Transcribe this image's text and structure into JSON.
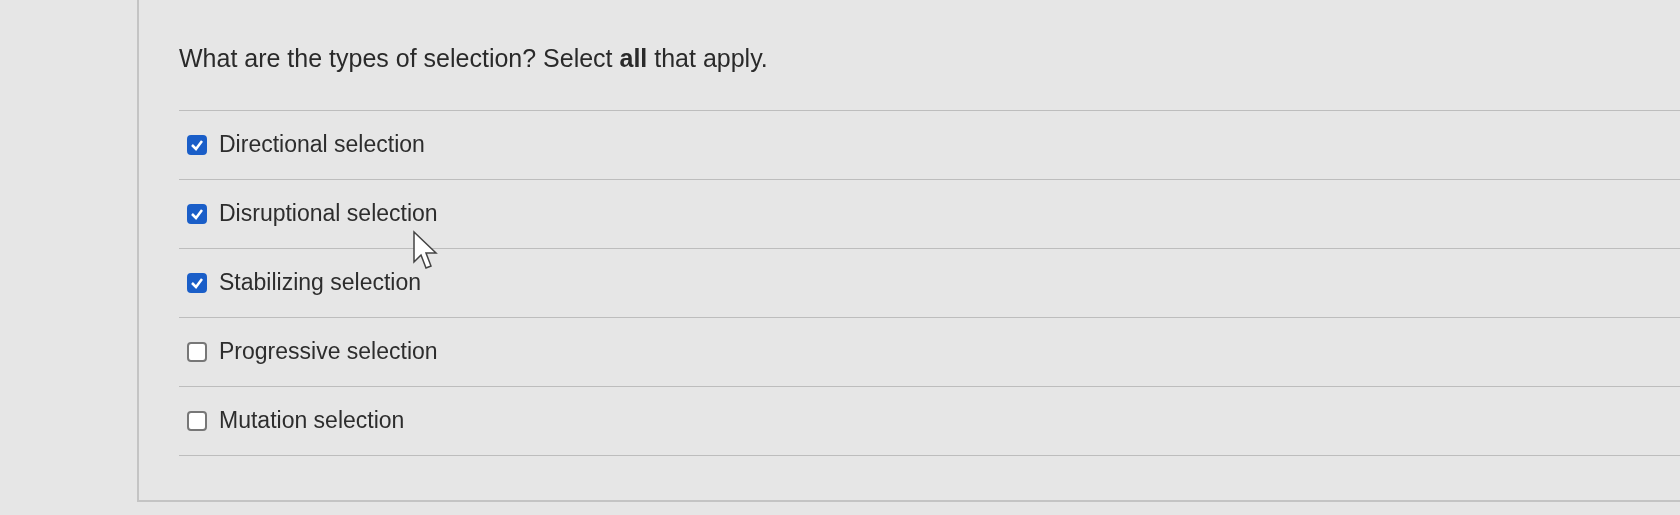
{
  "question": "What are the types of selection? Select **all** that apply.",
  "options": [
    {
      "label": "Directional selection",
      "checked": true
    },
    {
      "label": "Disruptional selection",
      "checked": true
    },
    {
      "label": "Stabilizing selection",
      "checked": true
    },
    {
      "label": "Progressive selection",
      "checked": false
    },
    {
      "label": "Mutation selection",
      "checked": false
    }
  ]
}
